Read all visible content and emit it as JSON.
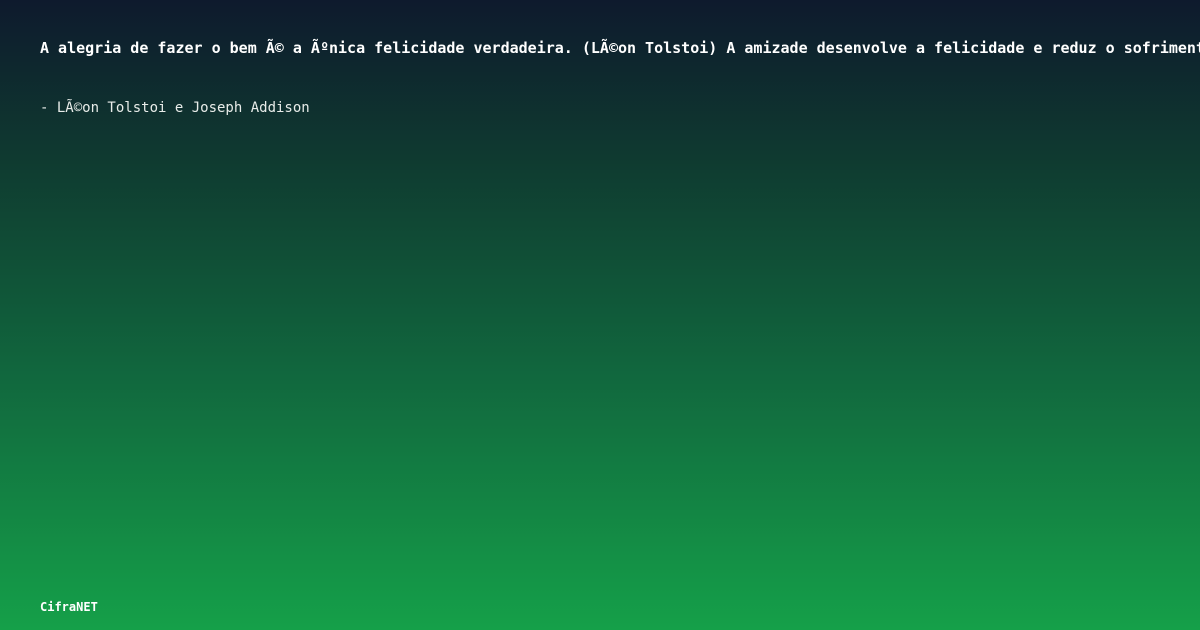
{
  "quote": {
    "text": "A alegria de fazer o bem Ã© a Ãºnica felicidade verdadeira. (LÃ©on Tolstoi) A amizade desenvolve a felicidade e reduz o sofrimento"
  },
  "author": {
    "text": "- LÃ©on Tolstoi e Joseph Addison"
  },
  "brand": {
    "name": "CifraNET"
  },
  "colors": {
    "gradient_top": "#0e1a2d",
    "gradient_bottom": "#15a049",
    "text": "#ffffff"
  }
}
